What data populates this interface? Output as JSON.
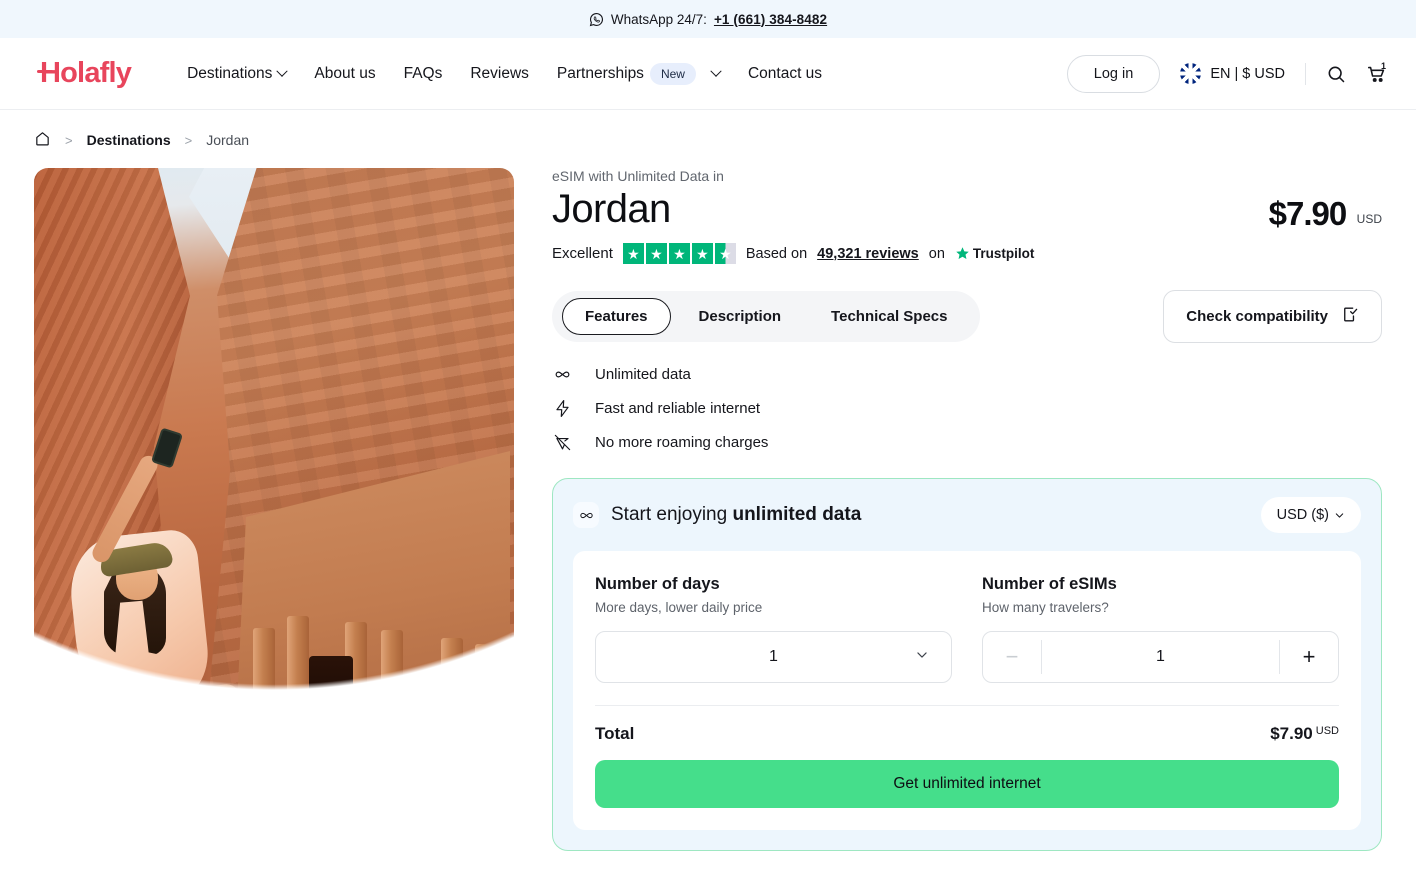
{
  "topbar": {
    "icon": "whatsapp-icon",
    "text": "WhatsApp 24/7:",
    "phone": "+1 (661) 384-8482"
  },
  "header": {
    "logo": "Holafly",
    "nav": [
      {
        "label": "Destinations",
        "has_chevron": true
      },
      {
        "label": "About us",
        "has_chevron": false
      },
      {
        "label": "FAQs",
        "has_chevron": false
      },
      {
        "label": "Reviews",
        "has_chevron": false
      },
      {
        "label": "Partnerships",
        "badge": "New",
        "has_chevron": true
      },
      {
        "label": "Contact us",
        "has_chevron": false
      }
    ],
    "login_label": "Log in",
    "locale": "EN | $ USD",
    "flag": "uk-flag-icon",
    "search_icon": "search-icon",
    "cart_icon": "cart-icon",
    "cart_count": "1"
  },
  "breadcrumb": {
    "home_icon": "home-icon",
    "sep": ">",
    "items": [
      "Destinations",
      "Jordan"
    ]
  },
  "product": {
    "eyebrow": "eSIM with Unlimited Data in",
    "title": "Jordan",
    "price": "$7.90",
    "currency": "USD",
    "hero_image_alt": "woman-taking-selfie-at-petra-treasury"
  },
  "rating": {
    "verdict": "Excellent",
    "stars_total": 5,
    "stars_filled": 4,
    "has_half_star": true,
    "based_on": "Based on",
    "reviews": "49,321 reviews",
    "on": "on",
    "platform": "Trustpilot",
    "star_color": "#00b67a"
  },
  "tabs": {
    "items": [
      {
        "label": "Features",
        "active": true
      },
      {
        "label": "Description",
        "active": false
      },
      {
        "label": "Technical Specs",
        "active": false
      }
    ],
    "compat_label": "Check compatibility",
    "compat_icon": "device-check-icon"
  },
  "features": [
    {
      "icon": "infinity-icon",
      "label": "Unlimited data"
    },
    {
      "icon": "lightning-bolt-icon",
      "label": "Fast and reliable internet"
    },
    {
      "icon": "no-roaming-icon",
      "label": "No more roaming charges"
    }
  ],
  "purchase": {
    "icon": "infinity-icon",
    "heading_light": "Start enjoying ",
    "heading_bold": "unlimited data",
    "currency_select": "USD ($)",
    "days": {
      "label": "Number of days",
      "sublabel": "More days, lower daily price",
      "value": "1",
      "chevron_icon": "chevron-down-icon"
    },
    "esims": {
      "label": "Number of eSIMs",
      "sublabel": "How many travelers?",
      "value": "1",
      "minus": "−",
      "plus": "+",
      "minus_disabled": true
    },
    "total_label": "Total",
    "total_value": "$7.90",
    "total_currency": "USD",
    "cta_label": "Get unlimited internet",
    "cta_color": "#45de8b",
    "border_color": "#9ee7c2",
    "bg_color": "#edf6fd"
  }
}
